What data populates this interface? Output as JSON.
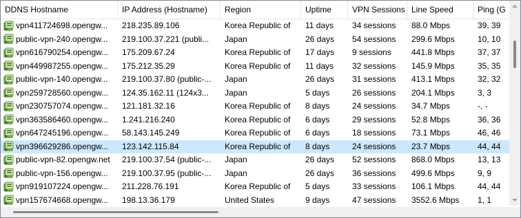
{
  "columns": [
    "DDNS Hostname",
    "IP Address (Hostname)",
    "Region",
    "Uptime",
    "VPN Sessions",
    "Line Speed",
    "Ping (G"
  ],
  "rows": [
    {
      "host": "vpn411724698.opengw...",
      "ip": "218.235.89.106",
      "region": "Korea Republic of",
      "uptime": "11 days",
      "sessions": "34 sessions",
      "speed": "88.0 Mbps",
      "ping": "39, 39"
    },
    {
      "host": "public-vpn-240.opengw...",
      "ip": "219.100.37.221 (publi...",
      "region": "Japan",
      "uptime": "26 days",
      "sessions": "54 sessions",
      "speed": "299.6 Mbps",
      "ping": "10, 10"
    },
    {
      "host": "vpn616790254.opengw...",
      "ip": "175.209.67.24",
      "region": "Korea Republic of",
      "uptime": "17 days",
      "sessions": "9 sessions",
      "speed": "441.8 Mbps",
      "ping": "37, 37"
    },
    {
      "host": "vpn449987255.opengw...",
      "ip": "175.212.35.29",
      "region": "Korea Republic of",
      "uptime": "11 days",
      "sessions": "32 sessions",
      "speed": "145.9 Mbps",
      "ping": "35, 35"
    },
    {
      "host": "public-vpn-140.opengw...",
      "ip": "219.100.37.80 (public-...",
      "region": "Japan",
      "uptime": "26 days",
      "sessions": "31 sessions",
      "speed": "413.1 Mbps",
      "ping": "32, 32"
    },
    {
      "host": "vpn259728560.opengw...",
      "ip": "124.35.162.11 (124x3...",
      "region": "Japan",
      "uptime": "5 days",
      "sessions": "26 sessions",
      "speed": "204.1 Mbps",
      "ping": "3, 3"
    },
    {
      "host": "vpn230757074.opengw...",
      "ip": "121.181.32.16",
      "region": "Korea Republic of",
      "uptime": "8 days",
      "sessions": "24 sessions",
      "speed": "34.7 Mbps",
      "ping": "-, -"
    },
    {
      "host": "vpn363586460.opengw...",
      "ip": "1.241.216.240",
      "region": "Korea Republic of",
      "uptime": "6 days",
      "sessions": "29 sessions",
      "speed": "52.8 Mbps",
      "ping": "36, 36"
    },
    {
      "host": "vpn647245196.opengw...",
      "ip": "58.143.145.249",
      "region": "Korea Republic of",
      "uptime": "6 days",
      "sessions": "18 sessions",
      "speed": "73.1 Mbps",
      "ping": "46, 46"
    },
    {
      "host": "vpn396629286.opengw...",
      "ip": "123.142.115.84",
      "region": "Korea Republic of",
      "uptime": "8 days",
      "sessions": "24 sessions",
      "speed": "23.7 Mbps",
      "ping": "44, 44",
      "selected": true
    },
    {
      "host": "public-vpn-82.opengw.net",
      "ip": "219.100.37.54 (public-...",
      "region": "Japan",
      "uptime": "26 days",
      "sessions": "52 sessions",
      "speed": "868.0 Mbps",
      "ping": "13, 13"
    },
    {
      "host": "public-vpn-156.opengw...",
      "ip": "219.100.37.95 (public-...",
      "region": "Japan",
      "uptime": "26 days",
      "sessions": "36 sessions",
      "speed": "499.6 Mbps",
      "ping": "9, 9"
    },
    {
      "host": "vpn919107224.opengw...",
      "ip": "211.228.76.191",
      "region": "Korea Republic of",
      "uptime": "5 days",
      "sessions": "33 sessions",
      "speed": "106.1 Mbps",
      "ping": "44, 44"
    },
    {
      "host": "vpn157674668.opengw...",
      "ip": "198.13.36.179",
      "region": "United States",
      "uptime": "9 days",
      "sessions": "47 sessions",
      "speed": "3552.6 Mbps",
      "ping": "1, 1"
    }
  ],
  "icons": {
    "row": "vpn-server-icon"
  },
  "colors": {
    "selected_row": "#cce8ff",
    "grid_line": "#e5e5e5",
    "border": "#828790"
  }
}
